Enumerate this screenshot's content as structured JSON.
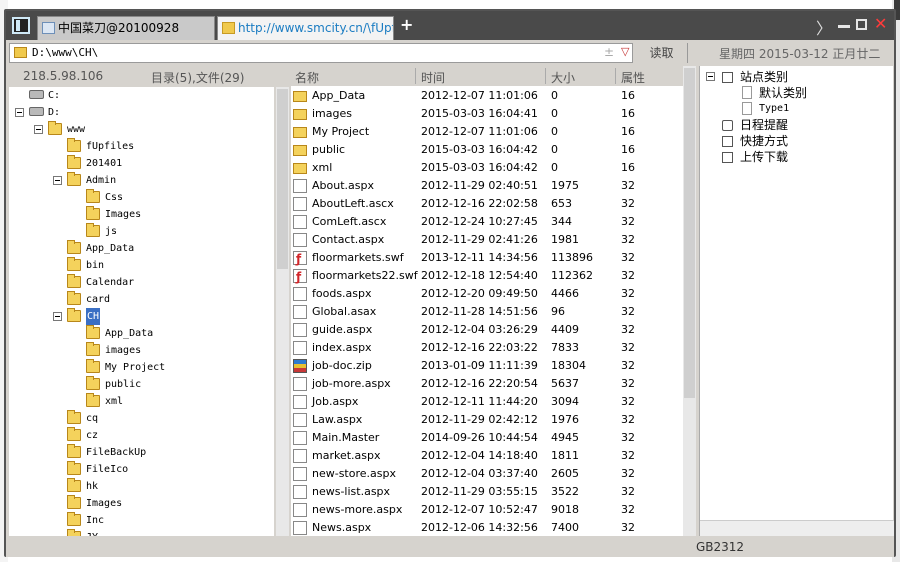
{
  "tabs": [
    {
      "label": "中国菜刀@20100928"
    },
    {
      "label": "http://www.smcity.cn/\\fUpfile..."
    }
  ],
  "titlebar": {
    "new_tab_label": "+",
    "more_label": "〉",
    "close_label": "✕"
  },
  "address": {
    "path": "D:\\www\\CH\\",
    "pm_label": "±",
    "dropdown_label": "▽",
    "read_label": "读取",
    "datetime": "星期四 2015-03-12 正月廿二"
  },
  "left_panel": {
    "ip": "218.5.98.106",
    "counts": "目录(5),文件(29)",
    "tree": [
      {
        "label": "C:",
        "type": "drive",
        "level": 0,
        "toggle": false
      },
      {
        "label": "D:",
        "type": "drive",
        "level": 0,
        "toggle": true
      },
      {
        "label": "www",
        "type": "folder",
        "level": 1,
        "toggle": true
      },
      {
        "label": "fUpfiles",
        "type": "folder",
        "level": 2,
        "toggle": false
      },
      {
        "label": "201401",
        "type": "folder",
        "level": 2,
        "toggle": false
      },
      {
        "label": "Admin",
        "type": "folder",
        "level": 2,
        "toggle": true
      },
      {
        "label": "Css",
        "type": "folder",
        "level": 3,
        "toggle": false
      },
      {
        "label": "Images",
        "type": "folder",
        "level": 3,
        "toggle": false
      },
      {
        "label": "js",
        "type": "folder",
        "level": 3,
        "toggle": false
      },
      {
        "label": "App_Data",
        "type": "folder",
        "level": 2,
        "toggle": false
      },
      {
        "label": "bin",
        "type": "folder",
        "level": 2,
        "toggle": false
      },
      {
        "label": "Calendar",
        "type": "folder",
        "level": 2,
        "toggle": false
      },
      {
        "label": "card",
        "type": "folder",
        "level": 2,
        "toggle": false
      },
      {
        "label": "CH",
        "type": "folder",
        "level": 2,
        "toggle": true,
        "selected": true
      },
      {
        "label": "App_Data",
        "type": "folder",
        "level": 3,
        "toggle": false
      },
      {
        "label": "images",
        "type": "folder",
        "level": 3,
        "toggle": false
      },
      {
        "label": "My Project",
        "type": "folder",
        "level": 3,
        "toggle": false
      },
      {
        "label": "public",
        "type": "folder",
        "level": 3,
        "toggle": false
      },
      {
        "label": "xml",
        "type": "folder",
        "level": 3,
        "toggle": false
      },
      {
        "label": "cq",
        "type": "folder",
        "level": 2,
        "toggle": false
      },
      {
        "label": "cz",
        "type": "folder",
        "level": 2,
        "toggle": false
      },
      {
        "label": "FileBackUp",
        "type": "folder",
        "level": 2,
        "toggle": false
      },
      {
        "label": "FileIco",
        "type": "folder",
        "level": 2,
        "toggle": false
      },
      {
        "label": "hk",
        "type": "folder",
        "level": 2,
        "toggle": false
      },
      {
        "label": "Images",
        "type": "folder",
        "level": 2,
        "toggle": false
      },
      {
        "label": "Inc",
        "type": "folder",
        "level": 2,
        "toggle": false
      },
      {
        "label": "JY",
        "type": "folder",
        "level": 2,
        "toggle": false
      }
    ]
  },
  "file_list": {
    "columns": [
      "名称",
      "时间",
      "大小",
      "属性"
    ],
    "rows": [
      {
        "name": "App_Data",
        "time": "2012-12-07 11:01:06",
        "size": "0",
        "attr": "16",
        "icon": "folder"
      },
      {
        "name": "images",
        "time": "2015-03-03 16:04:41",
        "size": "0",
        "attr": "16",
        "icon": "folder"
      },
      {
        "name": "My Project",
        "time": "2012-12-07 11:01:06",
        "size": "0",
        "attr": "16",
        "icon": "folder"
      },
      {
        "name": "public",
        "time": "2015-03-03 16:04:42",
        "size": "0",
        "attr": "16",
        "icon": "folder"
      },
      {
        "name": "xml",
        "time": "2015-03-03 16:04:42",
        "size": "0",
        "attr": "16",
        "icon": "folder"
      },
      {
        "name": "About.aspx",
        "time": "2012-11-29 02:40:51",
        "size": "1975",
        "attr": "32",
        "icon": "file"
      },
      {
        "name": "AboutLeft.ascx",
        "time": "2012-12-16 22:02:58",
        "size": "653",
        "attr": "32",
        "icon": "file"
      },
      {
        "name": "ComLeft.ascx",
        "time": "2012-12-24 10:27:45",
        "size": "344",
        "attr": "32",
        "icon": "file"
      },
      {
        "name": "Contact.aspx",
        "time": "2012-11-29 02:41:26",
        "size": "1981",
        "attr": "32",
        "icon": "file"
      },
      {
        "name": "floormarkets.swf",
        "time": "2013-12-11 14:34:56",
        "size": "113896",
        "attr": "32",
        "icon": "swf"
      },
      {
        "name": "floormarkets22.swf",
        "time": "2012-12-18 12:54:40",
        "size": "112362",
        "attr": "32",
        "icon": "swf"
      },
      {
        "name": "foods.aspx",
        "time": "2012-12-20 09:49:50",
        "size": "4466",
        "attr": "32",
        "icon": "file"
      },
      {
        "name": "Global.asax",
        "time": "2012-11-28 14:51:56",
        "size": "96",
        "attr": "32",
        "icon": "file"
      },
      {
        "name": "guide.aspx",
        "time": "2012-12-04 03:26:29",
        "size": "4409",
        "attr": "32",
        "icon": "file"
      },
      {
        "name": "index.aspx",
        "time": "2012-12-16 22:03:22",
        "size": "7833",
        "attr": "32",
        "icon": "file"
      },
      {
        "name": "job-doc.zip",
        "time": "2013-01-09 11:11:39",
        "size": "18304",
        "attr": "32",
        "icon": "zip"
      },
      {
        "name": "job-more.aspx",
        "time": "2012-12-16 22:20:54",
        "size": "5637",
        "attr": "32",
        "icon": "file"
      },
      {
        "name": "Job.aspx",
        "time": "2012-12-11 11:44:20",
        "size": "3094",
        "attr": "32",
        "icon": "file"
      },
      {
        "name": "Law.aspx",
        "time": "2012-11-29 02:42:12",
        "size": "1976",
        "attr": "32",
        "icon": "file"
      },
      {
        "name": "Main.Master",
        "time": "2014-09-26 10:44:54",
        "size": "4945",
        "attr": "32",
        "icon": "file"
      },
      {
        "name": "market.aspx",
        "time": "2012-12-04 14:18:40",
        "size": "1811",
        "attr": "32",
        "icon": "file"
      },
      {
        "name": "new-store.aspx",
        "time": "2012-12-04 03:37:40",
        "size": "2605",
        "attr": "32",
        "icon": "file"
      },
      {
        "name": "news-list.aspx",
        "time": "2012-11-29 03:55:15",
        "size": "3522",
        "attr": "32",
        "icon": "file"
      },
      {
        "name": "news-more.aspx",
        "time": "2012-12-07 10:52:47",
        "size": "9018",
        "attr": "32",
        "icon": "file"
      },
      {
        "name": "News.aspx",
        "time": "2012-12-06 14:32:56",
        "size": "7400",
        "attr": "32",
        "icon": "file"
      }
    ]
  },
  "right_panel": {
    "items": [
      {
        "label": "站点类别",
        "kind": "checkbox-toggle",
        "level": 0
      },
      {
        "label": "默认类别",
        "kind": "doc",
        "level": 1
      },
      {
        "label": "Type1",
        "kind": "doc",
        "level": 1
      },
      {
        "label": "日程提醒",
        "kind": "clock",
        "level": 0
      },
      {
        "label": "快捷方式",
        "kind": "hand",
        "level": 0
      },
      {
        "label": "上传下载",
        "kind": "checkbox",
        "level": 0
      }
    ]
  },
  "status": {
    "encoding": "GB2312"
  }
}
